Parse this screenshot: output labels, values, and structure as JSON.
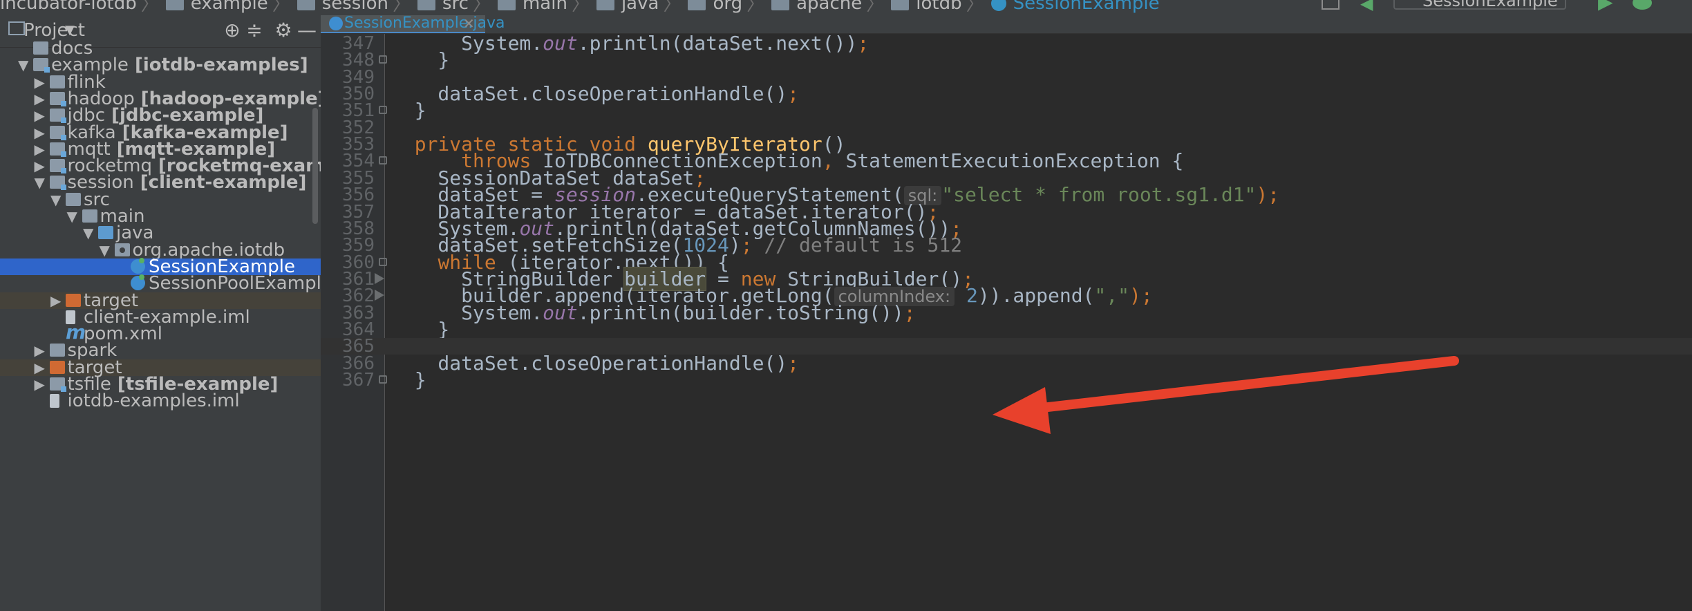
{
  "breadcrumb": [
    {
      "label": "incubator-iotdb"
    },
    {
      "label": "example"
    },
    {
      "label": "session"
    },
    {
      "label": "src"
    },
    {
      "label": "main"
    },
    {
      "label": "java"
    },
    {
      "label": "org"
    },
    {
      "label": "apache"
    },
    {
      "label": "iotdb"
    },
    {
      "label": "SessionExample"
    }
  ],
  "toolbar": {
    "run_config": "SessionExample"
  },
  "project_panel": {
    "title": "Project",
    "tree": [
      {
        "label": "docs",
        "icon": "folder-icon",
        "depth": 1
      },
      {
        "label": "example",
        "module": " [iotdb-examples]",
        "icon": "module-folder-icon",
        "arrow": "expanded",
        "depth": 1
      },
      {
        "label": "flink",
        "icon": "folder-icon",
        "arrow": "collapsed",
        "depth": 2
      },
      {
        "label": "hadoop",
        "module": " [hadoop-example]",
        "icon": "module-folder-icon",
        "arrow": "collapsed",
        "depth": 2
      },
      {
        "label": "jdbc",
        "module": " [jdbc-example]",
        "icon": "module-folder-icon",
        "arrow": "collapsed",
        "depth": 2
      },
      {
        "label": "kafka",
        "module": " [kafka-example]",
        "icon": "module-folder-icon",
        "arrow": "collapsed",
        "depth": 2
      },
      {
        "label": "mqtt",
        "module": " [mqtt-example]",
        "icon": "module-folder-icon",
        "arrow": "collapsed",
        "depth": 2
      },
      {
        "label": "rocketmq",
        "module": " [rocketmq-example]",
        "icon": "module-folder-icon",
        "arrow": "collapsed",
        "depth": 2
      },
      {
        "label": "session",
        "module": " [client-example]",
        "icon": "module-folder-icon",
        "arrow": "expanded",
        "depth": 2
      },
      {
        "label": "src",
        "icon": "folder-icon",
        "arrow": "expanded",
        "depth": 3
      },
      {
        "label": "main",
        "icon": "folder-icon",
        "arrow": "expanded",
        "depth": 4
      },
      {
        "label": "java",
        "icon": "source-folder-icon",
        "arrow": "expanded",
        "depth": 5
      },
      {
        "label": "org.apache.iotdb",
        "icon": "package-icon",
        "arrow": "expanded",
        "depth": 6
      },
      {
        "label": "SessionExample",
        "icon": "java-class-icon",
        "depth": 7,
        "selected": true
      },
      {
        "label": "SessionPoolExample",
        "icon": "java-class-icon",
        "depth": 7
      },
      {
        "label": "target",
        "icon": "excluded-folder-icon",
        "arrow": "collapsed",
        "depth": 3,
        "excluded": true
      },
      {
        "label": "client-example.iml",
        "icon": "iml-file-icon",
        "depth": 3
      },
      {
        "label": "pom.xml",
        "icon": "maven-icon",
        "depth": 3
      },
      {
        "label": "spark",
        "icon": "folder-icon",
        "arrow": "collapsed",
        "depth": 2
      },
      {
        "label": "target",
        "icon": "excluded-folder-icon",
        "arrow": "collapsed",
        "depth": 2,
        "excluded": true
      },
      {
        "label": "tsfile",
        "module": " [tsfile-example]",
        "icon": "module-folder-icon",
        "arrow": "collapsed",
        "depth": 2
      },
      {
        "label": "iotdb-examples.iml",
        "icon": "iml-file-icon",
        "depth": 2
      }
    ]
  },
  "editor": {
    "tab_label": "SessionExample.java",
    "caret_line": "365",
    "lines": [
      {
        "n": "347",
        "tokens": [
          [
            "      System.",
            "p"
          ],
          [
            "out",
            "st"
          ],
          [
            ".println(dataSet.next())",
            "p"
          ],
          [
            ";",
            "k"
          ]
        ]
      },
      {
        "n": "348",
        "tokens": [
          [
            "    }",
            "p"
          ]
        ],
        "fold": true
      },
      {
        "n": "349",
        "tokens": []
      },
      {
        "n": "350",
        "tokens": [
          [
            "    dataSet.closeOperationHandle()",
            "p"
          ],
          [
            ";",
            "k"
          ]
        ]
      },
      {
        "n": "351",
        "tokens": [
          [
            "  }",
            "p"
          ]
        ],
        "fold": true
      },
      {
        "n": "352",
        "tokens": []
      },
      {
        "n": "353",
        "tokens": [
          [
            "  ",
            "p"
          ],
          [
            "private static void ",
            "k"
          ],
          [
            "queryByIterator",
            "f"
          ],
          [
            "()",
            "p"
          ]
        ]
      },
      {
        "n": "354",
        "tokens": [
          [
            "      ",
            "p"
          ],
          [
            "throws ",
            "k"
          ],
          [
            "IoTDBConnectionException",
            "p"
          ],
          [
            ", ",
            "k"
          ],
          [
            "StatementExecutionException {",
            "p"
          ]
        ],
        "fold": true
      },
      {
        "n": "355",
        "tokens": [
          [
            "    SessionDataSet dataSet",
            "p"
          ],
          [
            ";",
            "k"
          ]
        ]
      },
      {
        "n": "356",
        "tokens": [
          [
            "    dataSet = ",
            "p"
          ],
          [
            "session",
            "st"
          ],
          [
            ".executeQueryStatement(",
            "p"
          ],
          [
            "sql:",
            "h"
          ],
          [
            "\"select * from root.sg1.d1\"",
            "s"
          ],
          [
            ");",
            "k"
          ]
        ]
      },
      {
        "n": "357",
        "tokens": [
          [
            "    DataIterator iterator = dataSet.iterator()",
            "p"
          ],
          [
            ";",
            "k"
          ]
        ]
      },
      {
        "n": "358",
        "tokens": [
          [
            "    System.",
            "p"
          ],
          [
            "out",
            "st"
          ],
          [
            ".println(dataSet.getColumnNames())",
            "p"
          ],
          [
            ";",
            "k"
          ]
        ]
      },
      {
        "n": "359",
        "tokens": [
          [
            "    dataSet.setFetchSize(",
            "p"
          ],
          [
            "1024",
            "n"
          ],
          [
            ")",
            "p"
          ],
          [
            "; ",
            "k"
          ],
          [
            "// default is 512",
            "c"
          ]
        ]
      },
      {
        "n": "360",
        "tokens": [
          [
            "    ",
            "p"
          ],
          [
            "while ",
            "k"
          ],
          [
            "(iterator.next()) {",
            "p"
          ]
        ],
        "fold": true
      },
      {
        "n": "361",
        "tokens": [
          [
            "      StringBuilder ",
            "p"
          ],
          [
            "builder",
            "hl"
          ],
          [
            " = ",
            "p"
          ],
          [
            "new ",
            "k"
          ],
          [
            "StringBuilder()",
            "p"
          ],
          [
            ";",
            "k"
          ]
        ],
        "bookmark": true
      },
      {
        "n": "362",
        "tokens": [
          [
            "      builder.append(iterator.getLong(",
            "p"
          ],
          [
            "columnIndex:",
            "h"
          ],
          [
            " ",
            "p"
          ],
          [
            "2",
            "n"
          ],
          [
            ")).append(",
            "p"
          ],
          [
            "\",\"",
            "s"
          ],
          [
            ");",
            "k"
          ]
        ],
        "bookmark": true
      },
      {
        "n": "363",
        "tokens": [
          [
            "      System.",
            "p"
          ],
          [
            "out",
            "st"
          ],
          [
            ".println(builder.toString())",
            "p"
          ],
          [
            ";",
            "k"
          ]
        ]
      },
      {
        "n": "364",
        "tokens": [
          [
            "    }",
            "p"
          ]
        ]
      },
      {
        "n": "365",
        "tokens": []
      },
      {
        "n": "366",
        "tokens": [
          [
            "    dataSet.closeOperationHandle()",
            "p"
          ],
          [
            ";",
            "k"
          ]
        ]
      },
      {
        "n": "367",
        "tokens": [
          [
            "  }",
            "p"
          ]
        ],
        "fold": true
      }
    ]
  },
  "colors": {
    "background": "#2b2b2b",
    "keyword": "#cc7832",
    "function": "#ffc66d",
    "string": "#6a8759",
    "number": "#6897bb",
    "static_field": "#9876aa",
    "selection": "#2f65ca",
    "annotation_arrow": "#e8412c"
  }
}
